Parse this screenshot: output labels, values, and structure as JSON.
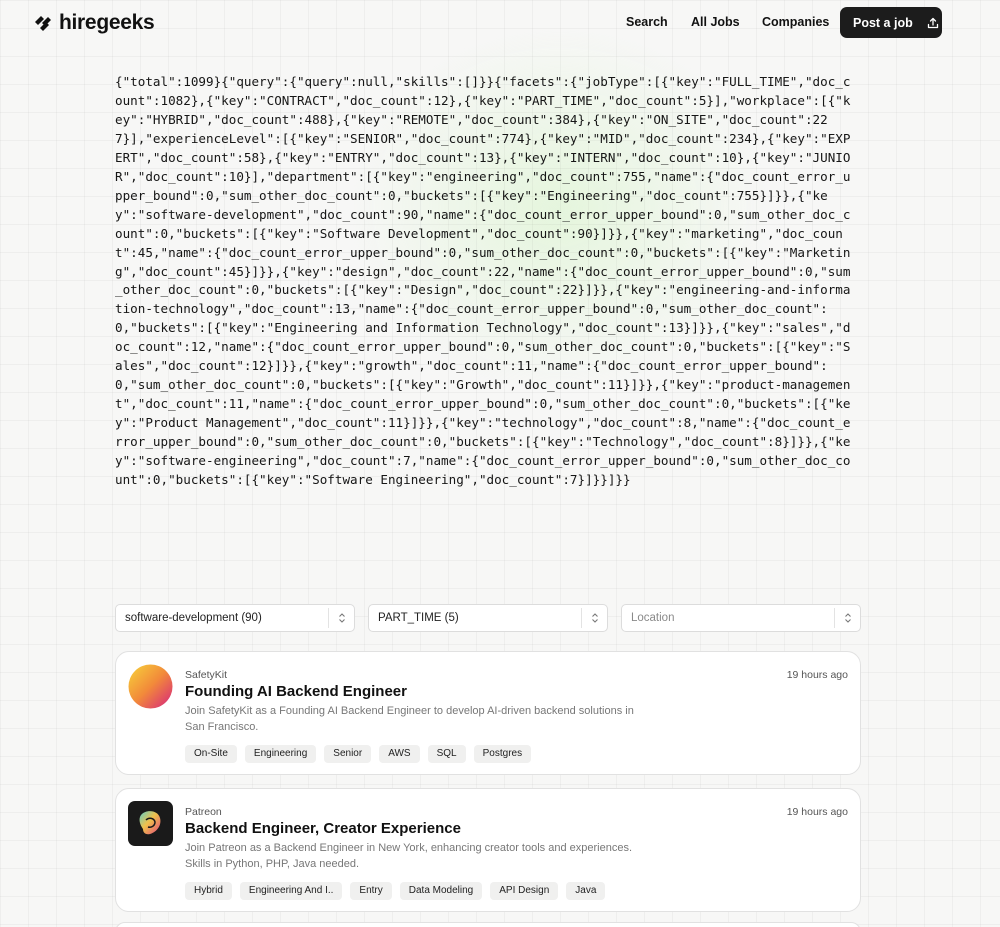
{
  "brand": {
    "name": "hiregeeks"
  },
  "nav": {
    "search": "Search",
    "all_jobs": "All Jobs",
    "companies": "Companies",
    "post_job": "Post a job"
  },
  "json_dump": "{\"total\":1099}{\"query\":{\"query\":null,\"skills\":[]}}{\"facets\":{\"jobType\":[{\"key\":\"FULL_TIME\",\"doc_count\":1082},{\"key\":\"CONTRACT\",\"doc_count\":12},{\"key\":\"PART_TIME\",\"doc_count\":5}],\"workplace\":[{\"key\":\"HYBRID\",\"doc_count\":488},{\"key\":\"REMOTE\",\"doc_count\":384},{\"key\":\"ON_SITE\",\"doc_count\":227}],\"experienceLevel\":[{\"key\":\"SENIOR\",\"doc_count\":774},{\"key\":\"MID\",\"doc_count\":234},{\"key\":\"EXPERT\",\"doc_count\":58},{\"key\":\"ENTRY\",\"doc_count\":13},{\"key\":\"INTERN\",\"doc_count\":10},{\"key\":\"JUNIOR\",\"doc_count\":10}],\"department\":[{\"key\":\"engineering\",\"doc_count\":755,\"name\":{\"doc_count_error_upper_bound\":0,\"sum_other_doc_count\":0,\"buckets\":[{\"key\":\"Engineering\",\"doc_count\":755}]}},{\"key\":\"software-development\",\"doc_count\":90,\"name\":{\"doc_count_error_upper_bound\":0,\"sum_other_doc_count\":0,\"buckets\":[{\"key\":\"Software Development\",\"doc_count\":90}]}},{\"key\":\"marketing\",\"doc_count\":45,\"name\":{\"doc_count_error_upper_bound\":0,\"sum_other_doc_count\":0,\"buckets\":[{\"key\":\"Marketing\",\"doc_count\":45}]}},{\"key\":\"design\",\"doc_count\":22,\"name\":{\"doc_count_error_upper_bound\":0,\"sum_other_doc_count\":0,\"buckets\":[{\"key\":\"Design\",\"doc_count\":22}]}},{\"key\":\"engineering-and-information-technology\",\"doc_count\":13,\"name\":{\"doc_count_error_upper_bound\":0,\"sum_other_doc_count\":0,\"buckets\":[{\"key\":\"Engineering and Information Technology\",\"doc_count\":13}]}},{\"key\":\"sales\",\"doc_count\":12,\"name\":{\"doc_count_error_upper_bound\":0,\"sum_other_doc_count\":0,\"buckets\":[{\"key\":\"Sales\",\"doc_count\":12}]}},{\"key\":\"growth\",\"doc_count\":11,\"name\":{\"doc_count_error_upper_bound\":0,\"sum_other_doc_count\":0,\"buckets\":[{\"key\":\"Growth\",\"doc_count\":11}]}},{\"key\":\"product-management\",\"doc_count\":11,\"name\":{\"doc_count_error_upper_bound\":0,\"sum_other_doc_count\":0,\"buckets\":[{\"key\":\"Product Management\",\"doc_count\":11}]}},{\"key\":\"technology\",\"doc_count\":8,\"name\":{\"doc_count_error_upper_bound\":0,\"sum_other_doc_count\":0,\"buckets\":[{\"key\":\"Technology\",\"doc_count\":8}]}},{\"key\":\"software-engineering\",\"doc_count\":7,\"name\":{\"doc_count_error_upper_bound\":0,\"sum_other_doc_count\":0,\"buckets\":[{\"key\":\"Software Engineering\",\"doc_count\":7}]}}]}}",
  "filters": {
    "department": "software-development (90)",
    "job_type": "PART_TIME (5)",
    "location_placeholder": "Location"
  },
  "jobs": [
    {
      "company": "SafetyKit",
      "posted": "19 hours ago",
      "title": "Founding AI Backend Engineer",
      "description": "Join SafetyKit as a Founding AI Backend Engineer to develop AI-driven backend solutions in San Francisco.",
      "tags": [
        "On-Site",
        "Engineering",
        "Senior",
        "AWS",
        "SQL",
        "Postgres"
      ],
      "logo": "gradient-circle-logo"
    },
    {
      "company": "Patreon",
      "posted": "19 hours ago",
      "title": "Backend Engineer, Creator Experience",
      "description": "Join Patreon as a Backend Engineer in New York, enhancing creator tools and experiences. Skills in Python, PHP, Java needed.",
      "tags": [
        "Hybrid",
        "Engineering And I..",
        "Entry",
        "Data Modeling",
        "API Design",
        "Java"
      ],
      "logo": "patreon-logo"
    }
  ]
}
